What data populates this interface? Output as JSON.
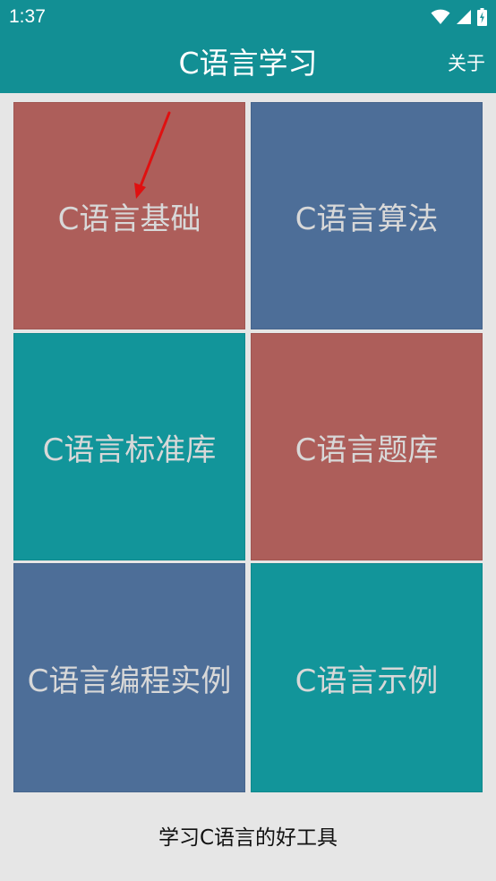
{
  "status_bar": {
    "time": "1:37",
    "icons": [
      "wifi-icon",
      "cellular-signal-icon",
      "battery-charging-icon"
    ]
  },
  "app_bar": {
    "title": "C语言学习",
    "about_label": "关于"
  },
  "tiles": [
    {
      "label": "C语言基础",
      "color": "#ad5e5a"
    },
    {
      "label": "C语言算法",
      "color": "#4d6e98"
    },
    {
      "label": "C语言标准库",
      "color": "#12959a"
    },
    {
      "label": "C语言题库",
      "color": "#ad5e5a"
    },
    {
      "label": "C语言编程实例",
      "color": "#4d6e98"
    },
    {
      "label": "C语言示例",
      "color": "#12959a"
    }
  ],
  "footer": {
    "text": "学习C语言的好工具"
  },
  "colors": {
    "primary": "#128f94",
    "annotation_arrow": "#e01010"
  }
}
